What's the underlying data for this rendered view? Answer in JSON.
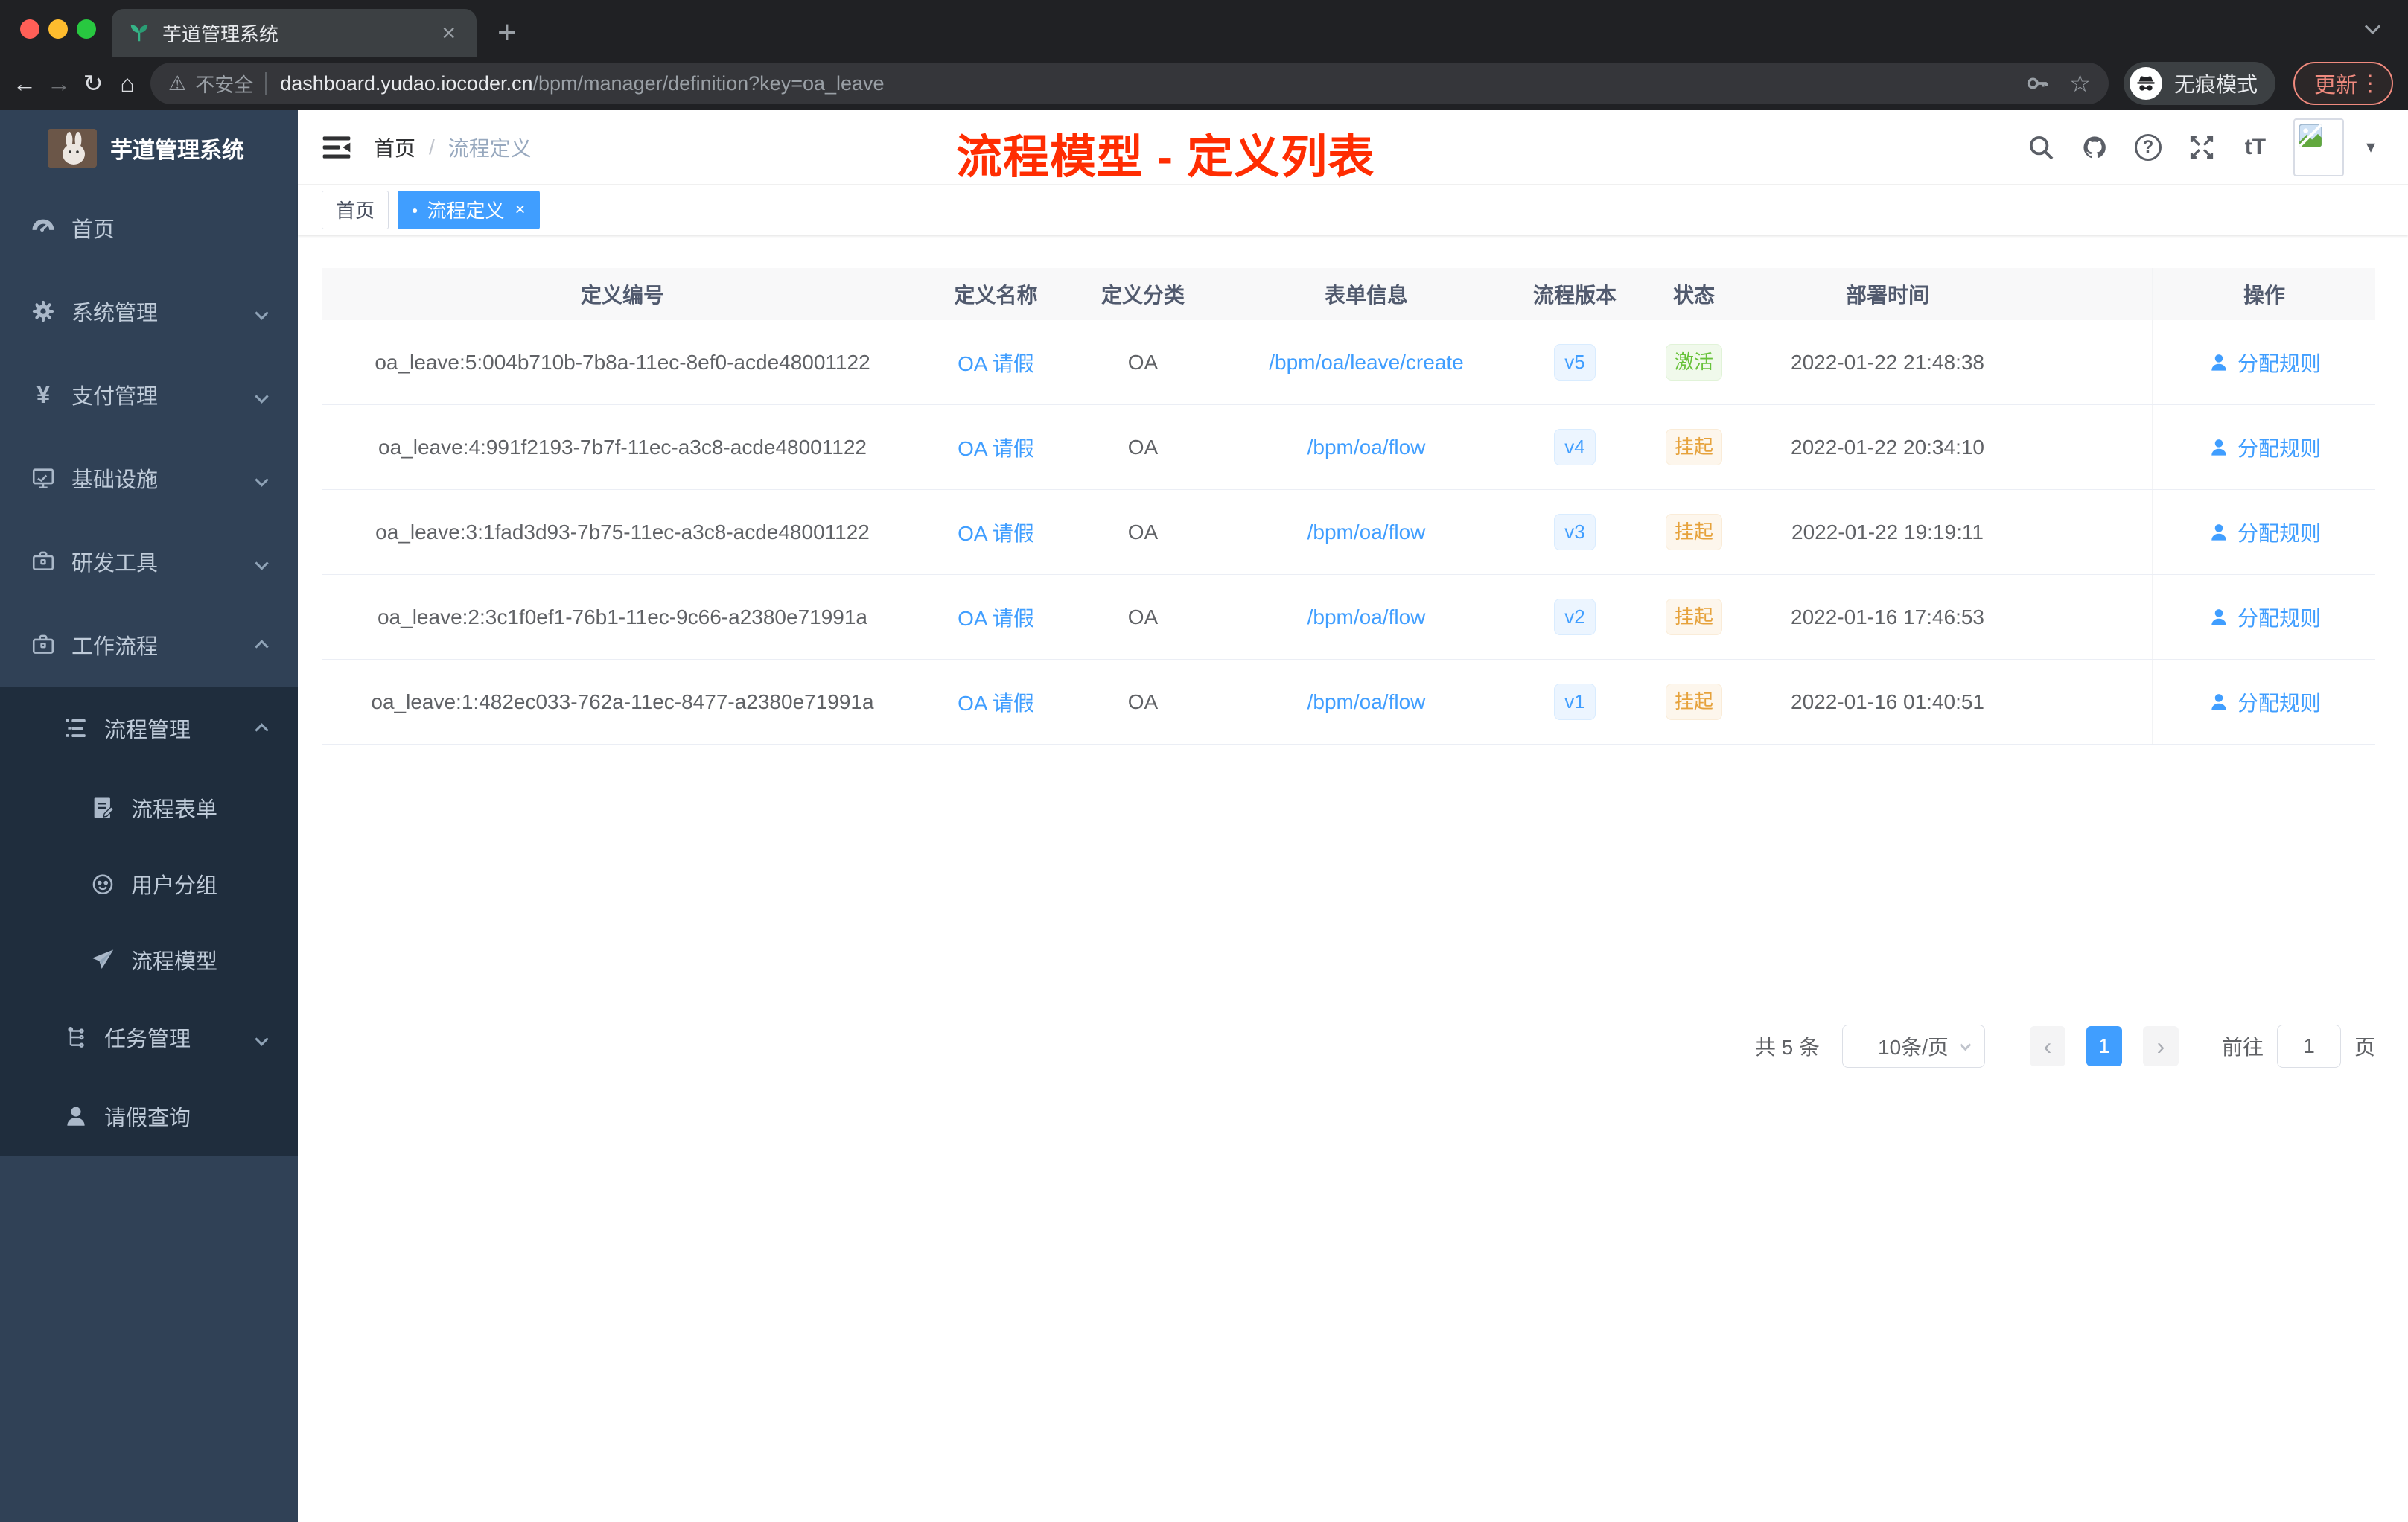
{
  "browser": {
    "tab_title": "芋道管理系统",
    "new_tab_glyph": "+",
    "close_tab_glyph": "×",
    "security_label": "不安全",
    "url_host": "dashboard.yudao.iocoder.cn",
    "url_path": "/bpm/manager/definition?key=oa_leave",
    "incognito_label": "无痕模式",
    "update_label": "更新"
  },
  "icons": {
    "back": "←",
    "forward": "→",
    "reload": "↻",
    "home": "⌂",
    "warning": "⚠",
    "star": "☆",
    "kebab": "⋮",
    "help": "?",
    "font_size": "tT",
    "yen": "¥",
    "tag_dot": "●",
    "tag_close": "×",
    "prev": "‹",
    "next": "›",
    "caret_down": "▾"
  },
  "sidebar": {
    "app_title": "芋道管理系统",
    "items": [
      {
        "label": "首页",
        "icon": "gauge-icon"
      },
      {
        "label": "系统管理",
        "icon": "gear-icon"
      },
      {
        "label": "支付管理",
        "icon": "yen-icon"
      },
      {
        "label": "基础设施",
        "icon": "monitor-icon"
      },
      {
        "label": "研发工具",
        "icon": "toolbox-icon"
      },
      {
        "label": "工作流程",
        "icon": "toolbox-icon"
      },
      {
        "label": "流程管理",
        "icon": "list-icon"
      },
      {
        "label": "流程表单",
        "icon": "form-icon"
      },
      {
        "label": "用户分组",
        "icon": "group-icon"
      },
      {
        "label": "流程模型",
        "icon": "send-icon"
      },
      {
        "label": "任务管理",
        "icon": "tree-icon"
      },
      {
        "label": "请假查询",
        "icon": "user-icon"
      }
    ]
  },
  "navbar": {
    "breadcrumb_home": "首页",
    "breadcrumb_sep": "/",
    "breadcrumb_current": "流程定义"
  },
  "annotation": "流程模型 - 定义列表",
  "tags": {
    "home": "首页",
    "active": "流程定义"
  },
  "table": {
    "columns": [
      "定义编号",
      "定义名称",
      "定义分类",
      "表单信息",
      "流程版本",
      "状态",
      "部署时间",
      "操作"
    ],
    "rows": [
      {
        "id": "oa_leave:5:004b710b-7b8a-11ec-8ef0-acde48001122",
        "name": "OA 请假",
        "category": "OA",
        "form": "/bpm/oa/leave/create",
        "version": "v5",
        "status": "激活",
        "time": "2022-01-22 21:48:38",
        "action": "分配规则"
      },
      {
        "id": "oa_leave:4:991f2193-7b7f-11ec-a3c8-acde48001122",
        "name": "OA 请假",
        "category": "OA",
        "form": "/bpm/oa/flow",
        "version": "v4",
        "status": "挂起",
        "time": "2022-01-22 20:34:10",
        "action": "分配规则"
      },
      {
        "id": "oa_leave:3:1fad3d93-7b75-11ec-a3c8-acde48001122",
        "name": "OA 请假",
        "category": "OA",
        "form": "/bpm/oa/flow",
        "version": "v3",
        "status": "挂起",
        "time": "2022-01-22 19:19:11",
        "action": "分配规则"
      },
      {
        "id": "oa_leave:2:3c1f0ef1-76b1-11ec-9c66-a2380e71991a",
        "name": "OA 请假",
        "category": "OA",
        "form": "/bpm/oa/flow",
        "version": "v2",
        "status": "挂起",
        "time": "2022-01-16 17:46:53",
        "action": "分配规则"
      },
      {
        "id": "oa_leave:1:482ec033-762a-11ec-8477-a2380e71991a",
        "name": "OA 请假",
        "category": "OA",
        "form": "/bpm/oa/flow",
        "version": "v1",
        "status": "挂起",
        "time": "2022-01-16 01:40:51",
        "action": "分配规则"
      }
    ]
  },
  "pagination": {
    "total": "共 5 条",
    "page_size": "10条/页",
    "page": "1",
    "goto_label": "前往",
    "goto_value": "1",
    "unit": "页"
  }
}
